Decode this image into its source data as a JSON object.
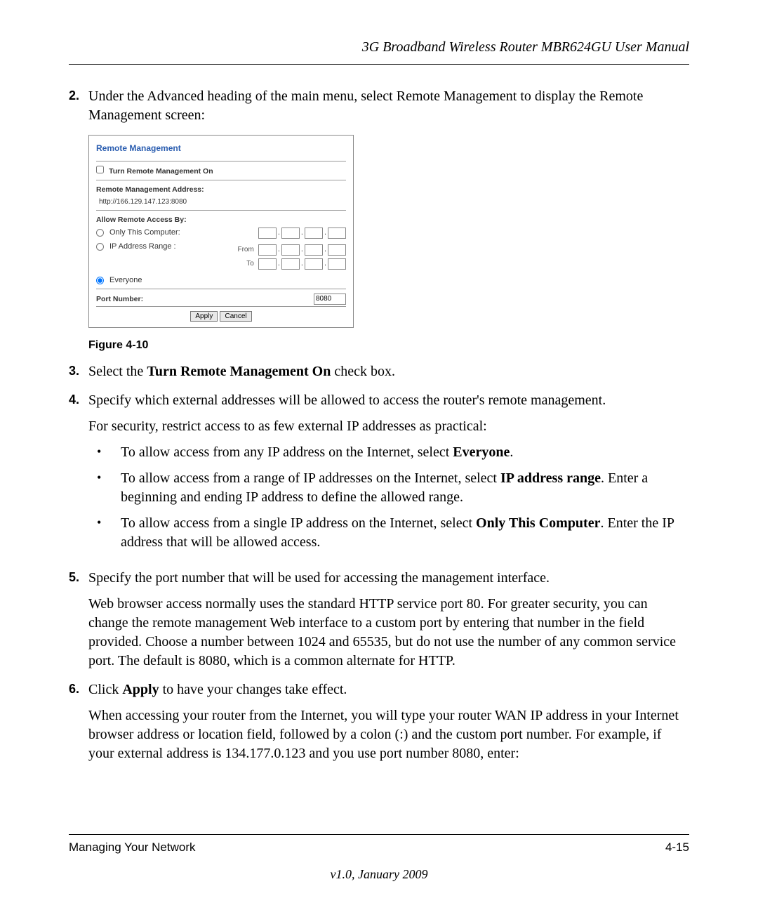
{
  "header": {
    "title": "3G Broadband Wireless Router MBR624GU User Manual"
  },
  "steps": {
    "s2": {
      "num": "2.",
      "text": "Under the Advanced heading of the main menu, select Remote Management to display the Remote Management screen:"
    },
    "s3": {
      "num": "3.",
      "pre": "Select the ",
      "bold": "Turn Remote Management On",
      "post": " check box."
    },
    "s4": {
      "num": "4.",
      "text": "Specify which external addresses will be allowed to access the router's remote management.",
      "sub": "For security, restrict access to as few external IP addresses as practical:",
      "bullets": [
        {
          "pre": "To allow access from any IP address on the Internet, select ",
          "bold": "Everyone",
          "post": "."
        },
        {
          "pre": "To allow access from a range of IP addresses on the Internet, select ",
          "bold": "IP address range",
          "post": ". Enter a beginning and ending IP address to define the allowed range."
        },
        {
          "pre": "To allow access from a single IP address on the Internet, select ",
          "bold": "Only This Computer",
          "post": ". Enter the IP address that will be allowed access."
        }
      ]
    },
    "s5": {
      "num": "5.",
      "text": "Specify the port number that will be used for accessing the management interface.",
      "para": "Web browser access normally uses the standard HTTP service port 80. For greater security, you can change the remote management Web interface to a custom port by entering that number in the field provided. Choose a number between 1024 and 65535, but do not use the number of any common service port. The default is 8080, which is a common alternate for HTTP."
    },
    "s6": {
      "num": "6.",
      "pre": "Click ",
      "bold": "Apply",
      "post": " to have your changes take effect.",
      "para": "When accessing your router from the Internet, you will type your router WAN IP address in your Internet browser address or location field, followed by a colon (:) and the custom port number. For example, if your external address is 134.177.0.123 and you use port number 8080, enter:"
    }
  },
  "figure": {
    "label": "Figure 4-10",
    "title": "Remote Management",
    "checkbox_label": "Turn Remote Management On",
    "addr_label": "Remote Management Address:",
    "addr_value": "http://166.129.147.123:8080",
    "allow_label": "Allow Remote Access By:",
    "opt_only": "Only This Computer:",
    "opt_range": "IP Address Range :",
    "from": "From",
    "to": "To",
    "opt_everyone": "Everyone",
    "port_label": "Port Number:",
    "port_value": "8080",
    "apply": "Apply",
    "cancel": "Cancel"
  },
  "footer": {
    "left": "Managing Your Network",
    "right": "4-15",
    "version": "v1.0, January 2009"
  }
}
